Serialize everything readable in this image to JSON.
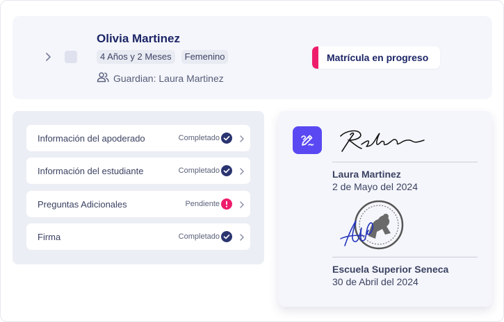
{
  "student": {
    "name": "Olivia Martinez",
    "age": "4 Años y 2 Meses",
    "gender": "Femenino",
    "guardian": "Guardian: Laura Martinez"
  },
  "status": {
    "label": "Matrícula en progreso",
    "color": "#ee1d6b"
  },
  "steps": [
    {
      "label": "Información del apoderado",
      "status": "Completado",
      "state": "done"
    },
    {
      "label": "Información del estudiante",
      "status": "Completado",
      "state": "done"
    },
    {
      "label": "Preguntas Adicionales",
      "status": "Pendiente",
      "state": "pending"
    },
    {
      "label": "Firma",
      "status": "Completado",
      "state": "done"
    }
  ],
  "signatures": [
    {
      "name": "Laura Martinez",
      "date": "2 de Mayo del 2024"
    },
    {
      "name": "Escuela Superior Seneca",
      "date": "30 de Abril del 2024"
    }
  ],
  "colors": {
    "accent": "#5a49f2",
    "done": "#2a3470",
    "pending": "#ee1d6b"
  }
}
